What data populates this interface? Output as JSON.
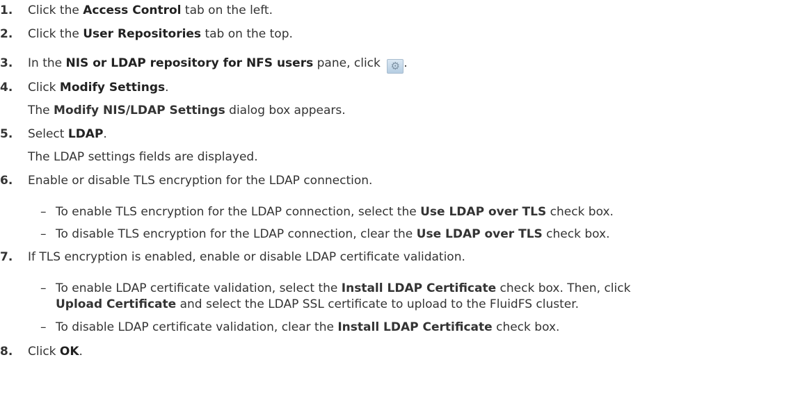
{
  "steps": [
    {
      "num": "1.",
      "parts": [
        "Click the ",
        "Access Control",
        " tab on the left."
      ]
    },
    {
      "num": "2.",
      "parts": [
        "Click the ",
        "User Repositories",
        " tab on the top."
      ]
    },
    {
      "num": "3.",
      "parts": [
        "In the ",
        "NIS or LDAP repository for NFS users",
        " pane, click ",
        "."
      ]
    },
    {
      "num": "4.",
      "parts": [
        "Click ",
        "Modify Settings",
        "."
      ],
      "result": [
        "The ",
        "Modify NIS/LDAP Settings",
        " dialog box appears."
      ]
    },
    {
      "num": "5.",
      "parts": [
        "Select ",
        "LDAP",
        "."
      ],
      "result": [
        "The LDAP settings fields are displayed."
      ]
    },
    {
      "num": "6.",
      "parts": [
        "Enable or disable TLS encryption for the LDAP connection."
      ],
      "bullets": [
        [
          "To enable TLS encryption for the LDAP connection, select the ",
          "Use LDAP over TLS",
          " check box."
        ],
        [
          "To disable TLS encryption for the LDAP connection, clear the ",
          "Use LDAP over TLS",
          " check box."
        ]
      ]
    },
    {
      "num": "7.",
      "parts": [
        "If TLS encryption is enabled, enable or disable LDAP certificate validation."
      ],
      "bullets": [
        [
          "To enable LDAP certificate validation, select the ",
          "Install LDAP Certificate",
          " check box. Then, click"
        ],
        [
          "Upload Certificate",
          " and select the LDAP SSL certificate to upload to the FluidFS cluster."
        ],
        [
          "To disable LDAP certificate validation, clear the ",
          "Install LDAP Certificate",
          " check box."
        ]
      ]
    },
    {
      "num": "8.",
      "parts": [
        "Click ",
        "OK",
        "."
      ]
    }
  ],
  "icons": {
    "settings_button": "gear-icon"
  },
  "bullet_dash": "–"
}
